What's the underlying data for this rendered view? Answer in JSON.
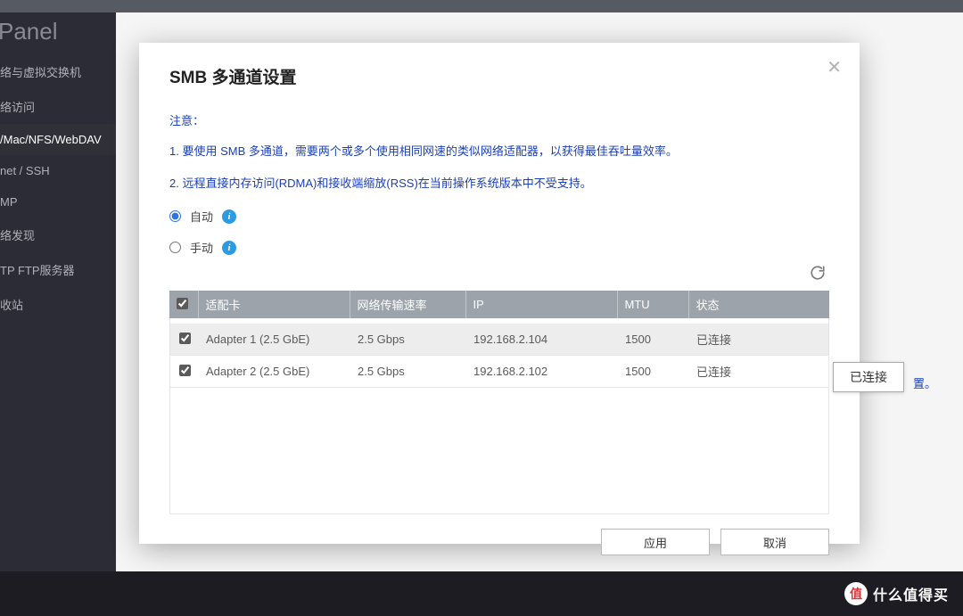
{
  "app_title": "Panel",
  "sidebar": {
    "items": [
      {
        "label": "络与虚拟交换机"
      },
      {
        "label": "络访问"
      },
      {
        "label": "/Mac/NFS/WebDAV"
      },
      {
        "label": "net / SSH"
      },
      {
        "label": "MP"
      },
      {
        "label": "络发现"
      },
      {
        "label": "TP FTP服务器"
      },
      {
        "label": "收站"
      }
    ],
    "active_index": 2
  },
  "dialog": {
    "title": "SMB 多通道设置",
    "note_header": "注意：",
    "note1": "1. 要使用 SMB 多通道，需要两个或多个使用相同网速的类似网络适配器，以获得最佳吞吐量效率。",
    "note2": "2. 远程直接内存访问(RDMA)和接收端缩放(RSS)在当前操作系统版本中不受支持。",
    "radio_auto": "自动",
    "radio_manual": "手动",
    "table": {
      "headers": {
        "adapter": "适配卡",
        "rate": "网络传输速率",
        "ip": "IP",
        "mtu": "MTU",
        "status": "状态"
      },
      "rows": [
        {
          "checked": true,
          "adapter": "Adapter 1 (2.5 GbE)",
          "rate": "2.5 Gbps",
          "ip": "192.168.2.104",
          "mtu": "1500",
          "status": "已连接"
        },
        {
          "checked": true,
          "adapter": "Adapter 2 (2.5 GbE)",
          "rate": "2.5 Gbps",
          "ip": "192.168.2.102",
          "mtu": "1500",
          "status": "已连接"
        }
      ]
    },
    "apply": "应用",
    "cancel": "取消"
  },
  "tooltip": "已连接",
  "tooltip_trail": "置。",
  "brand": {
    "symbol": "值",
    "text": "什么值得买"
  }
}
